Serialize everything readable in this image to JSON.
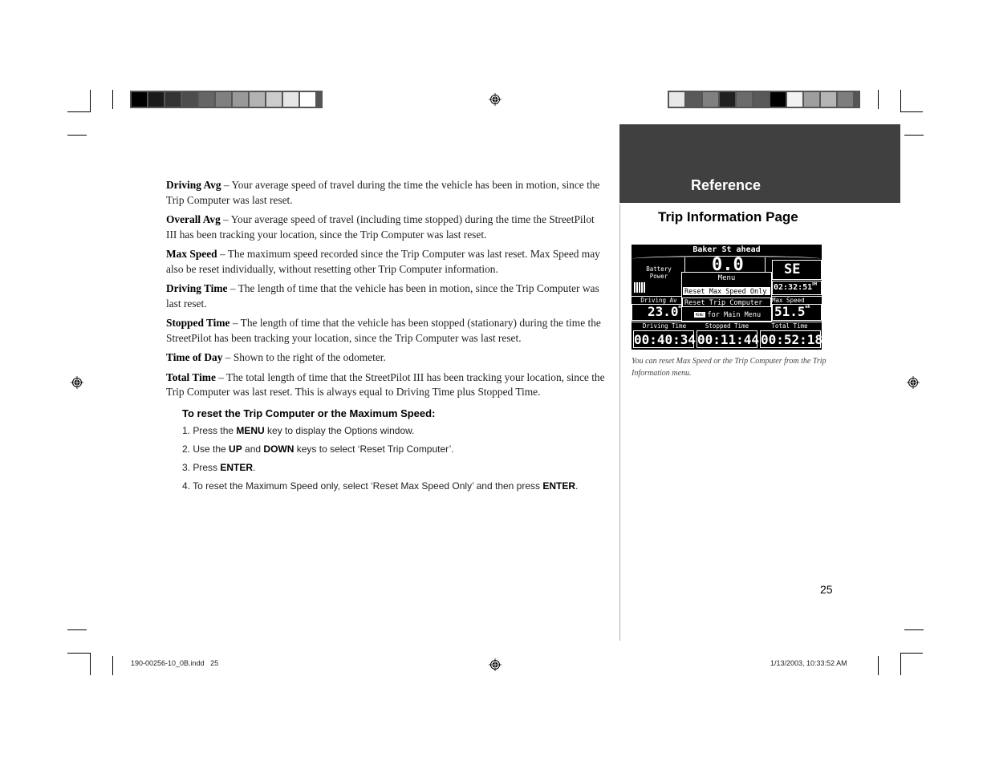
{
  "color_bars": {
    "left": [
      "#000000",
      "#1a1a1a",
      "#333333",
      "#4d4d4d",
      "#666666",
      "#808080",
      "#999999",
      "#b3b3b3",
      "#cccccc",
      "#e6e6e6",
      "#ffffff"
    ],
    "right": [
      "#e8e8e8",
      "#595959",
      "#808080",
      "#202020",
      "#6b6b6b",
      "#595959",
      "#000000",
      "#f2f2f2",
      "#9e9e9e",
      "#b5b5b5",
      "#7d7d7d"
    ]
  },
  "header": {
    "section_tab": "Reference",
    "section_title": "Trip Information Page"
  },
  "definitions": [
    {
      "term": "Driving Avg",
      "text": " – Your average speed of travel during the time the vehicle has been in motion, since the Trip Computer was last reset."
    },
    {
      "term": "Overall Avg",
      "text": " – Your average speed of travel (including time stopped) during the time the StreetPilot III has been tracking your location, since the Trip Computer was last reset."
    },
    {
      "term": "Max Speed",
      "text": " – The maximum speed recorded since the Trip Computer was last reset.  Max Speed may also be reset individually, without resetting other Trip Computer information."
    },
    {
      "term": "Driving Time",
      "text": " – The length of time that the vehicle has been in motion, since the Trip Computer was last reset."
    },
    {
      "term": "Stopped Time",
      "text": " – The length of time that the vehicle has been stopped (stationary) during the time the StreetPilot has been tracking your location, since the Trip Computer was last reset."
    },
    {
      "term": "Time of Day",
      "text": " – Shown to the right of the odometer."
    },
    {
      "term": "Total Time",
      "text": " – The total length of time that the StreetPilot III has been tracking your location, since the Trip Computer was last reset.  This is always equal to Driving Time plus Stopped Time."
    }
  ],
  "procedure": {
    "title": "To reset the Trip Computer or the Maximum Speed:",
    "steps": [
      {
        "num": "1.",
        "parts": [
          {
            "t": " Press the "
          },
          {
            "b": "MENU"
          },
          {
            "t": " key to display the Options window."
          }
        ]
      },
      {
        "num": "2.",
        "parts": [
          {
            "t": " Use the "
          },
          {
            "b": "UP"
          },
          {
            "t": " and "
          },
          {
            "b": "DOWN"
          },
          {
            "t": " keys to select ‘Reset Trip Computer’."
          }
        ]
      },
      {
        "num": "3.",
        "parts": [
          {
            "t": " Press "
          },
          {
            "b": "ENTER"
          },
          {
            "t": "."
          }
        ]
      },
      {
        "num": "4.",
        "parts": [
          {
            "t": " To reset the Maximum Speed only, select ‘Reset Max Speed Only’ and then press "
          },
          {
            "b": "ENTER"
          },
          {
            "t": "."
          }
        ]
      }
    ]
  },
  "gps_screen": {
    "street": "Baker St ahead",
    "battery_label_1": "Battery",
    "battery_label_2": "Power",
    "battery_bars": 5,
    "speed": "0.0",
    "speed_unit": "mh",
    "heading": "SE",
    "time_of_day": "02:32:51",
    "time_suffix": "PM",
    "driving_avg_label": "Driving Av",
    "driving_avg": "23.0",
    "max_speed_label": "Max Speed",
    "max_speed": "51.5",
    "menu_title": "Menu",
    "menu_items": [
      "Reset Max Speed Only",
      "Reset Trip Computer"
    ],
    "menu_selected": 0,
    "menu_hint_key": "MENU",
    "menu_hint": "for Main Menu",
    "driving_time_label": "Driving Time",
    "driving_time": "00:40:34",
    "stopped_time_label": "Stopped Time",
    "stopped_time": "00:11:44",
    "total_time_label": "Total Time",
    "total_time": "00:52:18"
  },
  "caption": "You can reset Max Speed or the Trip Computer from the Trip Information menu.",
  "page_number": "25",
  "footer": {
    "file": "190-00256-10_0B.indd   25",
    "timestamp": "1/13/2003, 10:33:52 AM"
  },
  "icons": {
    "registration": "registration-target-icon"
  }
}
